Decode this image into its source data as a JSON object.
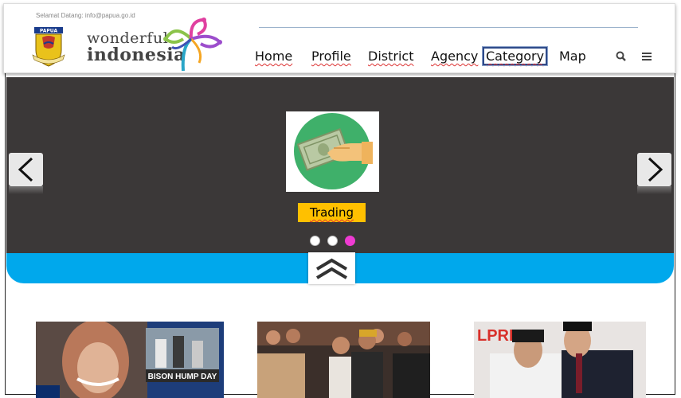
{
  "header": {
    "welcome_text": "Selamat Datang: info@papua.go.id",
    "emblem_label": "PAPUA",
    "logo_line1": "wonderful",
    "logo_line2": "indonesia"
  },
  "nav": {
    "items": [
      {
        "label": "Home"
      },
      {
        "label": "Profile"
      },
      {
        "label": "District"
      },
      {
        "label": "Agency"
      },
      {
        "label": "Category"
      },
      {
        "label": "Map"
      }
    ],
    "active_index": 4,
    "search_icon": "search-icon",
    "menu_icon": "menu-list-icon"
  },
  "slider": {
    "caption": "Trading",
    "slide_icon": "money-hand-icon",
    "dot_count": 3,
    "active_dot": 3,
    "prev_icon": "chevron-left-icon",
    "next_icon": "chevron-right-icon",
    "collapse_icon": "chevron-up-icon"
  },
  "news": {
    "thumb1_caption": "BISON HUMP DAY",
    "thumb3_banner": "LPRE 20"
  },
  "colors": {
    "slider_bg": "#3b3838",
    "accent_blue": "#00a8ec",
    "caption_bg": "#ffc000",
    "active_dot": "#ee3bd2"
  }
}
